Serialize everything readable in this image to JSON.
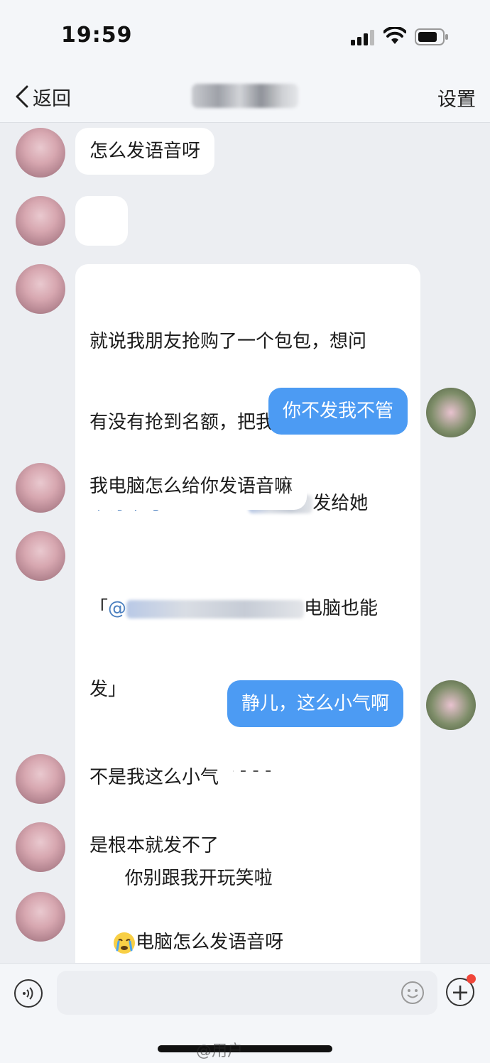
{
  "status_bar": {
    "time": "19:59"
  },
  "nav": {
    "back_label": "返回",
    "title": "chat-contact-name",
    "settings_label": "设置"
  },
  "messages": [
    {
      "from": "them",
      "text": "怎么发语音呀"
    },
    {
      "from": "them",
      "emoji": "crying-face"
    },
    {
      "from": "them",
      "lines": [
        "就说我朋友抢购了一个包包，想问",
        "有没有抢到名额，把我的名字和这",
        "个订单号 DHL 548",
        "发给她"
      ]
    },
    {
      "from": "me",
      "text": "你不发我不管"
    },
    {
      "from": "them",
      "text": "我电脑怎么给你发语音嘛"
    },
    {
      "from": "them",
      "quote_start": "「",
      "quote_at": "@",
      "quote_tail": "电脑也能",
      "quote_line2": "发」",
      "divider": "- - - - - - - - - - - - - - -",
      "reply": "你别跟我开玩笑啦"
    },
    {
      "from": "me",
      "text": "静儿，这么小气啊"
    },
    {
      "from": "them",
      "text": "不是我这么小气"
    },
    {
      "from": "them",
      "text": "是根本就发不了"
    },
    {
      "from": "them",
      "text": "电脑怎么发语音呀"
    }
  ],
  "composer": {
    "placeholder": ""
  },
  "watermark": "@用户"
}
